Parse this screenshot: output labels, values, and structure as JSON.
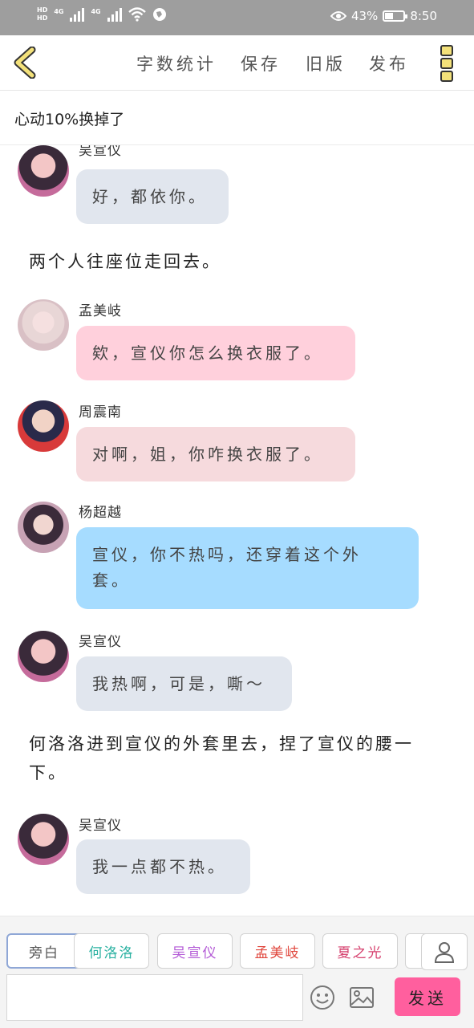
{
  "status_bar": {
    "hd_top": "HD",
    "hd_bottom": "HD",
    "net1": "4G",
    "net2": "4G",
    "battery_percent": "43%",
    "battery_level": 0.43,
    "time": "8:50"
  },
  "toolbar": {
    "word_count": "字数统计",
    "save": "保存",
    "old_version": "旧版",
    "publish": "发布"
  },
  "doc_title": "心动10%换掉了",
  "chat": {
    "m1_speaker": "吴宣仪",
    "m1_text": "好，都依你。",
    "n1_text": "两个人往座位走回去。",
    "m2_speaker": "孟美岐",
    "m2_text": "欸，宣仪你怎么换衣服了。",
    "m3_speaker": "周震南",
    "m3_text": "对啊，姐，你咋换衣服了。",
    "m4_speaker": "杨超越",
    "m4_text_line1": "宣仪，你不热吗，还穿着这个外",
    "m4_text_line2": "套。",
    "m5_speaker": "吴宣仪",
    "m5_text": "我热啊，可是，嘶～",
    "n2_line1": "何洛洛进到宣仪的外套里去，捏了宣仪的腰一",
    "n2_line2": "下。",
    "m6_speaker": "吴宣仪",
    "m6_text": "我一点都不热。"
  },
  "roles": {
    "narrator": "旁白",
    "r1": "何洛洛",
    "r2": "吴宣仪",
    "r3": "孟美岐",
    "r4": "夏之光"
  },
  "colors": {
    "narrator": "#555555",
    "r1": "#2ab1a1",
    "r2": "#b35ad6",
    "r3": "#e0463c",
    "r4": "#d6426f",
    "bubble_grey": "#e1e6ee",
    "bubble_pink": "#ffd0dc",
    "bubble_rose": "#f6dadd",
    "bubble_blue": "#a6dcff",
    "send_bg": "#ff5f9e"
  },
  "composer": {
    "input_value": "",
    "send": "发送"
  }
}
